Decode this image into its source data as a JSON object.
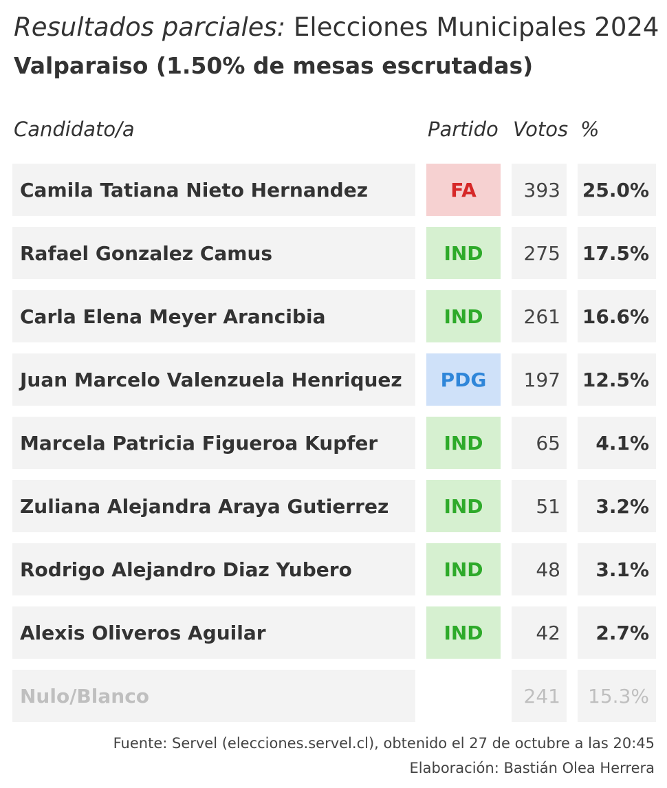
{
  "header": {
    "title_italic": "Resultados parciales:",
    "title_rest": " Elecciones Municipales 2024",
    "commune": "Valparaiso",
    "progress_text": " (1.50% de mesas escrutadas)"
  },
  "columns": {
    "candidate": "Candidato/a",
    "party": "Partido",
    "votes": "Votos",
    "pct": "%"
  },
  "party_colors": {
    "FA": {
      "bg": "#f6d1d1",
      "fg": "#d62828"
    },
    "IND": {
      "bg": "#d6f0d0",
      "fg": "#2eaa2a"
    },
    "PDG": {
      "bg": "#cfe1f9",
      "fg": "#2f86d9"
    }
  },
  "chart_data": {
    "type": "table",
    "columns": [
      "Candidato/a",
      "Partido",
      "Votos",
      "%"
    ],
    "rows": [
      {
        "candidate": "Camila Tatiana Nieto Hernandez",
        "party": "FA",
        "votes": "393",
        "pct": "25.0%"
      },
      {
        "candidate": "Rafael Gonzalez Camus",
        "party": "IND",
        "votes": "275",
        "pct": "17.5%"
      },
      {
        "candidate": "Carla Elena Meyer Arancibia",
        "party": "IND",
        "votes": "261",
        "pct": "16.6%"
      },
      {
        "candidate": "Juan Marcelo Valenzuela Henriquez",
        "party": "PDG",
        "votes": "197",
        "pct": "12.5%"
      },
      {
        "candidate": "Marcela Patricia Figueroa Kupfer",
        "party": "IND",
        "votes": "65",
        "pct": "4.1%"
      },
      {
        "candidate": "Zuliana Alejandra Araya Gutierrez",
        "party": "IND",
        "votes": "51",
        "pct": "3.2%"
      },
      {
        "candidate": "Rodrigo Alejandro Diaz Yubero",
        "party": "IND",
        "votes": "48",
        "pct": "3.1%"
      },
      {
        "candidate": "Alexis Oliveros Aguilar",
        "party": "IND",
        "votes": "42",
        "pct": "2.7%"
      },
      {
        "candidate": "Nulo/Blanco",
        "party": "",
        "votes": "241",
        "pct": "15.3%",
        "muted": true
      }
    ]
  },
  "footer": {
    "source": "Fuente: Servel (elecciones.servel.cl), obtenido el 27 de octubre a las 20:45",
    "credit": "Elaboración: Bastián Olea Herrera"
  }
}
